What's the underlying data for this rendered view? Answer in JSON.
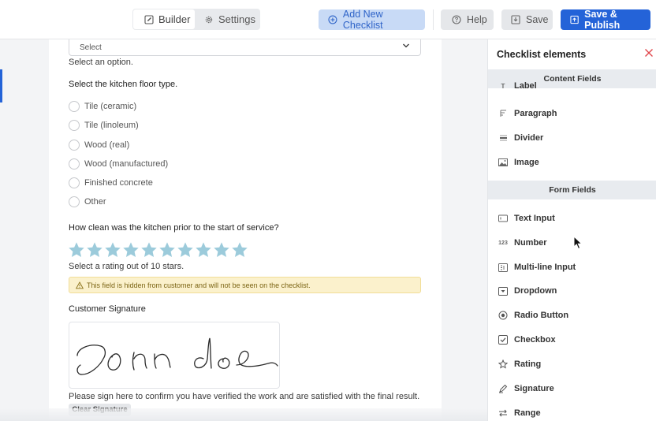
{
  "toolbar": {
    "builder_label": "Builder",
    "settings_label": "Settings",
    "add_checklist_label": "Add New Checklist",
    "help_label": "Help",
    "save_label": "Save",
    "publish_label": "Save & Publish"
  },
  "form": {
    "select_value": "Select",
    "select_help": "Select an option.",
    "floor_question": "Select the kitchen floor type.",
    "floor_options": [
      "Tile (ceramic)",
      "Tile (linoleum)",
      "Wood (real)",
      "Wood (manufactured)",
      "Finished concrete",
      "Other"
    ],
    "rating_question": "How clean was the kitchen prior to the start of service?",
    "rating": {
      "value": 10,
      "max": 10
    },
    "rating_help": "Select a rating out of 10 stars.",
    "hidden_warning": "This field is hidden from customer and will not be seen on the checklist.",
    "signature_label": "Customer Signature",
    "signature_help": "Please sign here to confirm you have verified the work and are satisfied with the final result.",
    "clear_signature_label": "Clear Signature"
  },
  "panel": {
    "title": "Checklist elements",
    "content_section": "Content Fields",
    "content_items": [
      {
        "label": "Label",
        "icon": "label-icon"
      },
      {
        "label": "Paragraph",
        "icon": "paragraph-icon"
      },
      {
        "label": "Divider",
        "icon": "divider-icon"
      },
      {
        "label": "Image",
        "icon": "image-icon"
      }
    ],
    "form_section": "Form Fields",
    "form_items": [
      {
        "label": "Text Input",
        "icon": "text-input-icon"
      },
      {
        "label": "Number",
        "icon": "number-icon",
        "icon_text": "123"
      },
      {
        "label": "Multi-line Input",
        "icon": "multiline-icon"
      },
      {
        "label": "Dropdown",
        "icon": "dropdown-icon"
      },
      {
        "label": "Radio Button",
        "icon": "radio-icon"
      },
      {
        "label": "Checkbox",
        "icon": "checkbox-icon"
      },
      {
        "label": "Rating",
        "icon": "rating-icon"
      },
      {
        "label": "Signature",
        "icon": "signature-icon"
      },
      {
        "label": "Range",
        "icon": "range-icon"
      }
    ]
  },
  "colors": {
    "primary": "#2463d8",
    "star": "#9ccbdb",
    "warning_bg": "#fbf1cc",
    "close": "#e0464b"
  }
}
